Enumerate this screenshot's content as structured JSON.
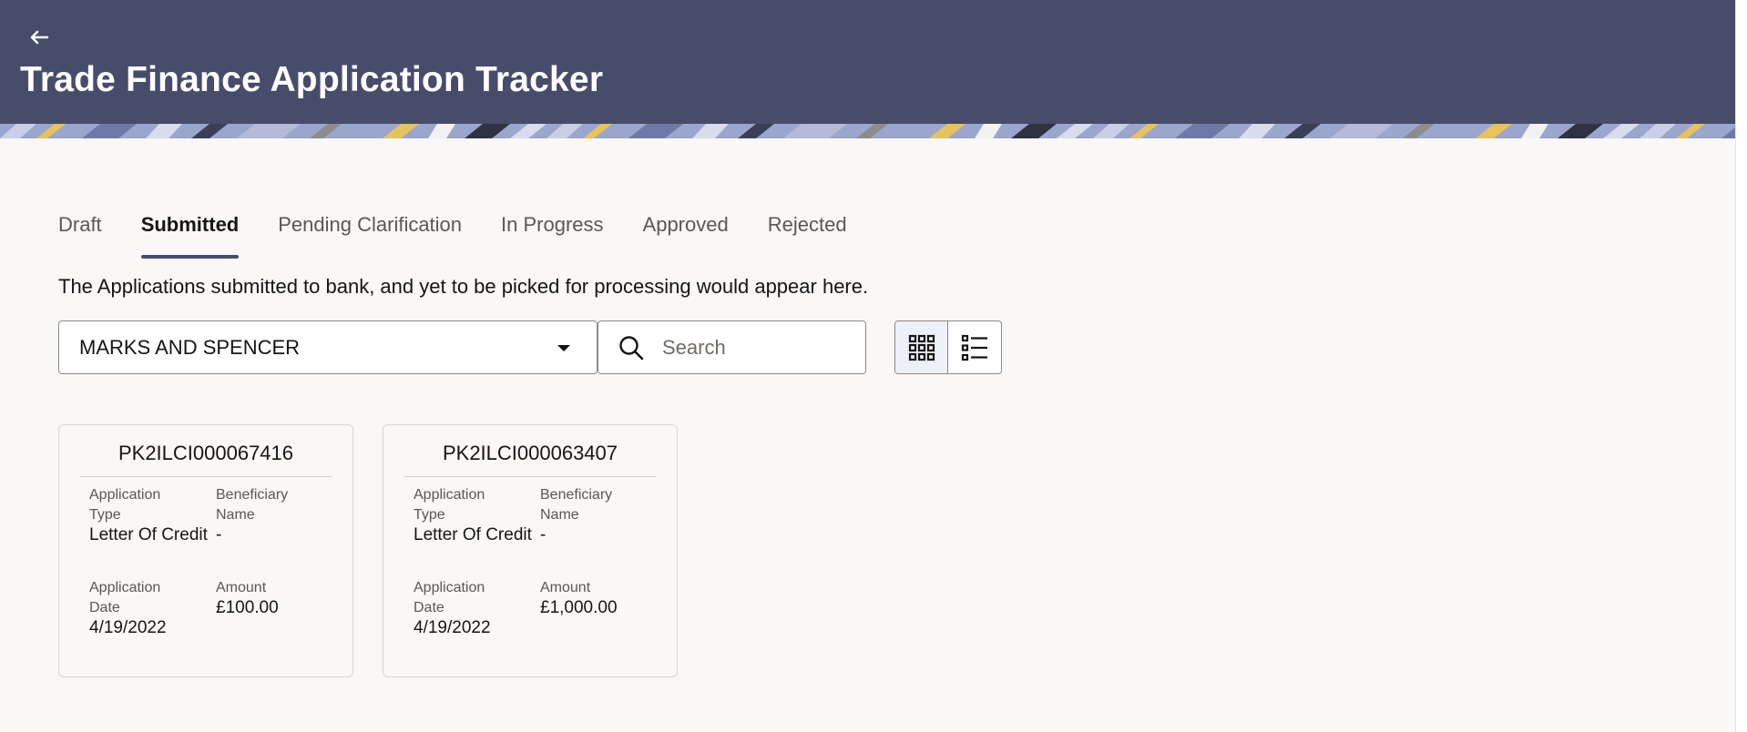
{
  "header": {
    "back_icon": "arrow-left-icon",
    "title": "Trade Finance Application Tracker",
    "background": "#474c6b"
  },
  "tabs": [
    {
      "label": "Draft",
      "active": false
    },
    {
      "label": "Submitted",
      "active": true
    },
    {
      "label": "Pending Clarification",
      "active": false
    },
    {
      "label": "In Progress",
      "active": false
    },
    {
      "label": "Approved",
      "active": false
    },
    {
      "label": "Rejected",
      "active": false
    }
  ],
  "description": "The Applications submitted to bank, and yet to be picked for processing would appear here.",
  "filters": {
    "party_select": {
      "value": "MARKS AND SPENCER"
    },
    "search": {
      "placeholder": "Search",
      "value": ""
    },
    "view_mode": "grid"
  },
  "cards": [
    {
      "reference": "PK2ILCI000067416",
      "application_type_label": "Application Type",
      "application_type": "Letter Of Credit",
      "beneficiary_label": "Beneficiary Name",
      "beneficiary": "-",
      "date_label": "Application Date",
      "date": "4/19/2022",
      "amount_label": "Amount",
      "amount": "£100.00"
    },
    {
      "reference": "PK2ILCI000063407",
      "application_type_label": "Application Type",
      "application_type": "Letter Of Credit",
      "beneficiary_label": "Beneficiary Name",
      "beneficiary": "-",
      "date_label": "Application Date",
      "date": "4/19/2022",
      "amount_label": "Amount",
      "amount": "£1,000.00"
    }
  ]
}
